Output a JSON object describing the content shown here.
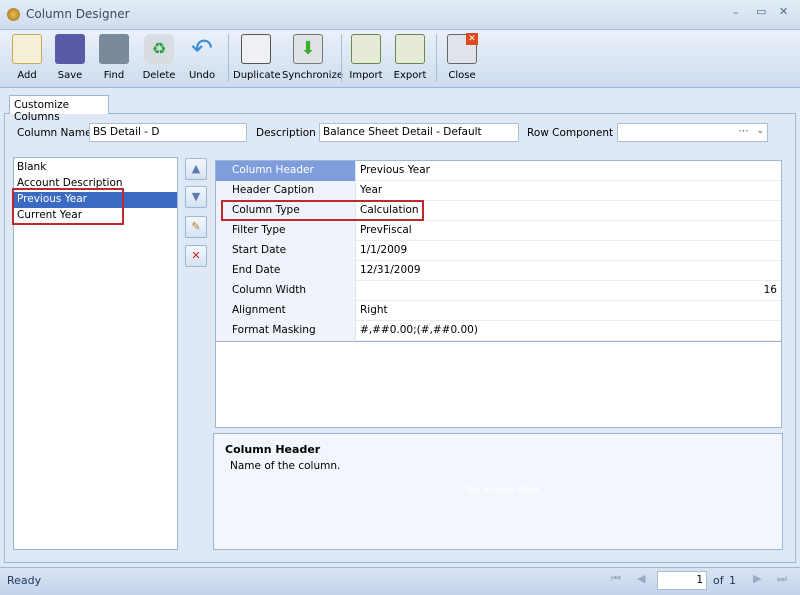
{
  "window": {
    "title": "Column Designer",
    "controls": [
      "minimize",
      "maximize",
      "close"
    ]
  },
  "toolbar": [
    {
      "label": "Add",
      "icon": "add-icon"
    },
    {
      "label": "Save",
      "icon": "save-icon"
    },
    {
      "label": "Find",
      "icon": "find-icon"
    },
    {
      "label": "Delete",
      "icon": "delete-icon"
    },
    {
      "label": "Undo",
      "icon": "undo-icon"
    },
    {
      "label": "Duplicate",
      "icon": "duplicate-icon"
    },
    {
      "label": "Synchronize",
      "icon": "synchronize-icon"
    },
    {
      "label": "Import",
      "icon": "import-icon"
    },
    {
      "label": "Export",
      "icon": "export-icon"
    },
    {
      "label": "Close",
      "icon": "close-icon"
    }
  ],
  "tab": "Customize Columns",
  "fields": {
    "column_name_label": "Column Name",
    "column_name": "BS Detail - D",
    "description_label": "Description",
    "description": "Balance Sheet Detail - Default",
    "row_component_label": "Row Component",
    "row_component": ""
  },
  "columns": [
    "Blank",
    "Account Description",
    "Previous Year",
    "Current Year"
  ],
  "selected_column": "Previous Year",
  "properties": [
    {
      "key": "Column Header",
      "value": "Previous Year"
    },
    {
      "key": "Header Caption",
      "value": "Year"
    },
    {
      "key": "Column Type",
      "value": "Calculation"
    },
    {
      "key": "Filter Type",
      "value": "PrevFiscal"
    },
    {
      "key": "Start Date",
      "value": "1/1/2009"
    },
    {
      "key": "End Date",
      "value": "12/31/2009"
    },
    {
      "key": "Column Width",
      "value": "16"
    },
    {
      "key": "Alignment",
      "value": "Right"
    },
    {
      "key": "Format Masking",
      "value": "#,##0.00;(#,##0.00)"
    }
  ],
  "help": {
    "title": "Column Header",
    "text": "Name of the column.",
    "watermark": "No image data"
  },
  "status": {
    "text": "Ready",
    "page": "1",
    "of_label": "of",
    "total": "1"
  }
}
